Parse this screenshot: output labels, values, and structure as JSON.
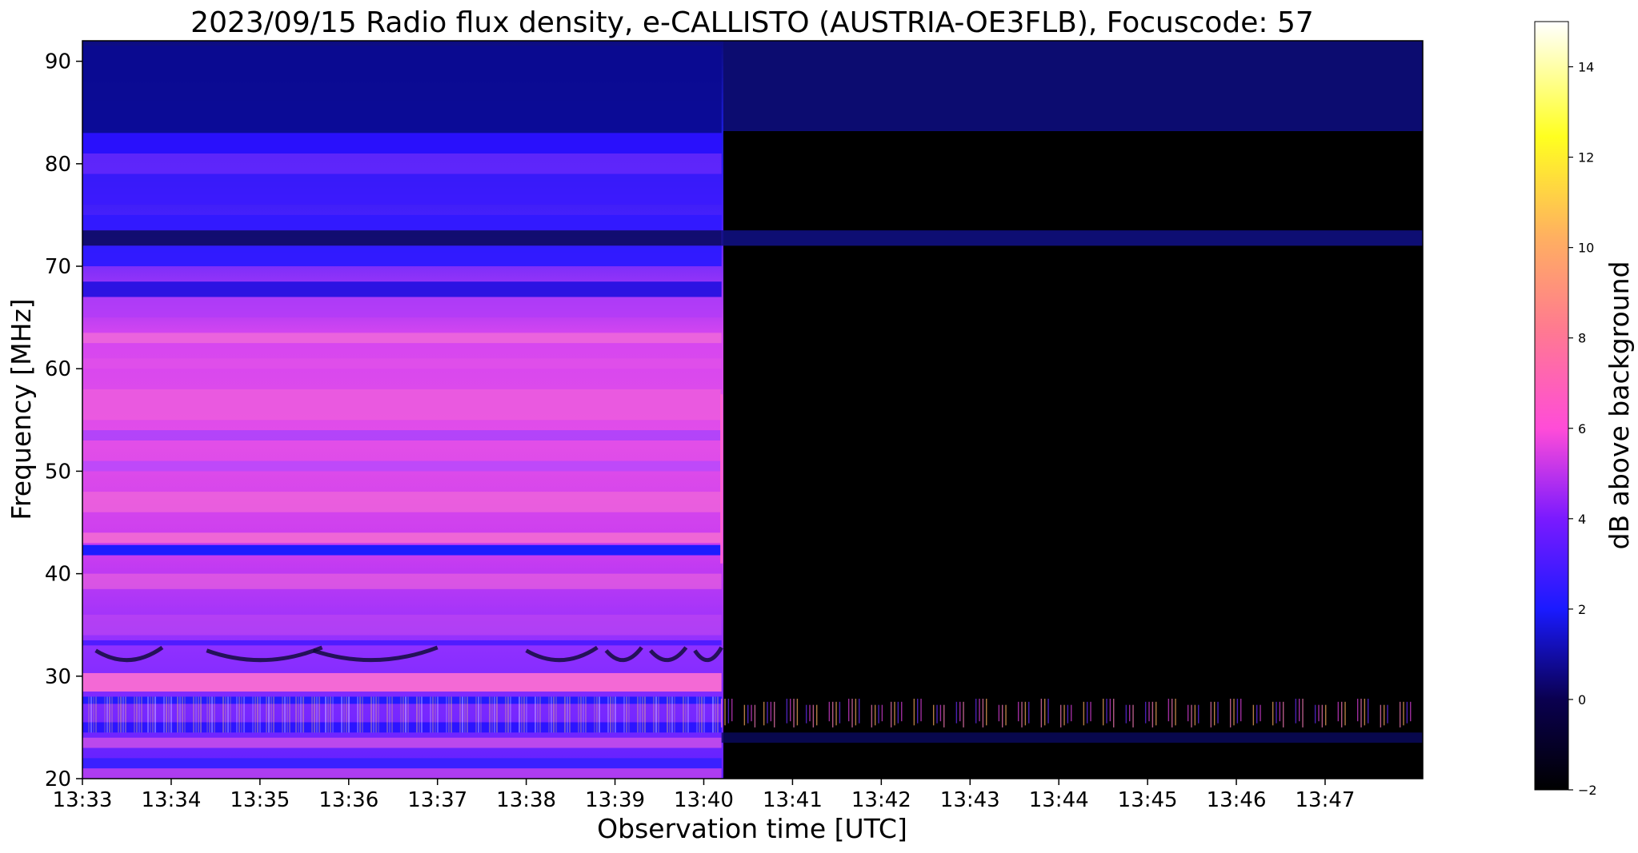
{
  "chart_data": {
    "type": "heatmap",
    "title": "2023/09/15  Radio flux density, e-CALLISTO (AUSTRIA-OE3FLB), Focuscode: 57",
    "xlabel": "Observation time [UTC]",
    "ylabel": "Frequency [MHz]",
    "x_ticks": [
      "13:33",
      "13:34",
      "13:35",
      "13:36",
      "13:37",
      "13:38",
      "13:39",
      "13:40",
      "13:41",
      "13:42",
      "13:43",
      "13:44",
      "13:45",
      "13:46",
      "13:47"
    ],
    "x_range_minutes": [
      0,
      15.1
    ],
    "y_ticks": [
      20,
      30,
      40,
      50,
      60,
      70,
      80,
      90
    ],
    "ylim": [
      20,
      92
    ],
    "colorbar": {
      "label": "dB above background",
      "ticks": [
        -2,
        0,
        2,
        4,
        6,
        8,
        10,
        12,
        14
      ],
      "range": [
        -2,
        15
      ],
      "colors": [
        "#000000",
        "#0000ff",
        "#ff00ff",
        "#ffff00",
        "#ffffff"
      ]
    },
    "regions": [
      {
        "t_start": "13:33",
        "t_end": "13:40:12",
        "freq_range": [
          20,
          92
        ],
        "level_db": "2 to 8",
        "note": "receiver active, strong background bands"
      },
      {
        "t_start": "13:40:12",
        "t_end": "13:48",
        "freq_range": [
          20,
          82
        ],
        "level_db": "-2 to 0",
        "note": "low level"
      },
      {
        "t_start": "13:40:12",
        "t_end": "13:48",
        "freq_range": [
          82,
          92
        ],
        "level_db": "0 to 2"
      }
    ]
  }
}
